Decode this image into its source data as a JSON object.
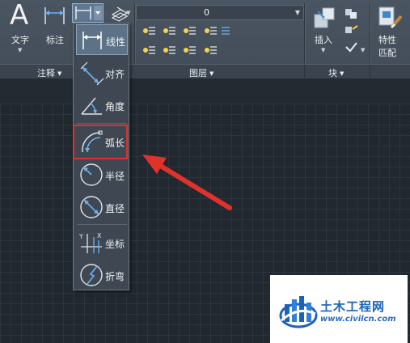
{
  "ribbon": {
    "annotate": {
      "text_label": "文字",
      "dimension_label": "标注",
      "panel_label": "注释"
    },
    "layers": {
      "current_layer": "0",
      "panel_label": "图层"
    },
    "block": {
      "insert_label": "插入",
      "panel_label": "块"
    },
    "properties": {
      "match_label_line1": "特性",
      "match_label_line2": "匹配"
    }
  },
  "dimension_menu": {
    "items": [
      {
        "label": "线性",
        "icon": "linear-dimension-icon"
      },
      {
        "label": "对齐",
        "icon": "aligned-dimension-icon"
      },
      {
        "label": "角度",
        "icon": "angular-dimension-icon"
      },
      {
        "label": "弧长",
        "icon": "arc-length-dimension-icon"
      },
      {
        "label": "半径",
        "icon": "radius-dimension-icon"
      },
      {
        "label": "直径",
        "icon": "diameter-dimension-icon"
      },
      {
        "label": "坐标",
        "icon": "ordinate-dimension-icon"
      },
      {
        "label": "折弯",
        "icon": "jogged-dimension-icon"
      }
    ],
    "selected": "线性",
    "highlighted": "弧长"
  },
  "colors": {
    "highlight_box": "#e0312b",
    "arrow": "#e0312b",
    "canvas_bg": "#212830",
    "ribbon_bg": "#4a5562"
  },
  "watermark": {
    "title": "土木工程网",
    "url": "www.civilcn.com"
  }
}
